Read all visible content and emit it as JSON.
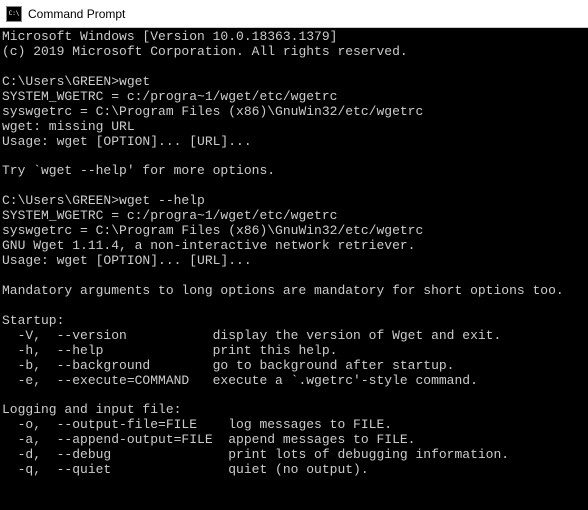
{
  "titlebar": {
    "title": "Command Prompt"
  },
  "terminal": {
    "lines": [
      "Microsoft Windows [Version 10.0.18363.1379]",
      "(c) 2019 Microsoft Corporation. All rights reserved.",
      "",
      "C:\\Users\\GREEN>wget",
      "SYSTEM_WGETRC = c:/progra~1/wget/etc/wgetrc",
      "syswgetrc = C:\\Program Files (x86)\\GnuWin32/etc/wgetrc",
      "wget: missing URL",
      "Usage: wget [OPTION]... [URL]...",
      "",
      "Try `wget --help' for more options.",
      "",
      "C:\\Users\\GREEN>wget --help",
      "SYSTEM_WGETRC = c:/progra~1/wget/etc/wgetrc",
      "syswgetrc = C:\\Program Files (x86)\\GnuWin32/etc/wgetrc",
      "GNU Wget 1.11.4, a non-interactive network retriever.",
      "Usage: wget [OPTION]... [URL]...",
      "",
      "Mandatory arguments to long options are mandatory for short options too.",
      "",
      "Startup:",
      "  -V,  --version           display the version of Wget and exit.",
      "  -h,  --help              print this help.",
      "  -b,  --background        go to background after startup.",
      "  -e,  --execute=COMMAND   execute a `.wgetrc'-style command.",
      "",
      "Logging and input file:",
      "  -o,  --output-file=FILE    log messages to FILE.",
      "  -a,  --append-output=FILE  append messages to FILE.",
      "  -d,  --debug               print lots of debugging information.",
      "  -q,  --quiet               quiet (no output)."
    ]
  }
}
